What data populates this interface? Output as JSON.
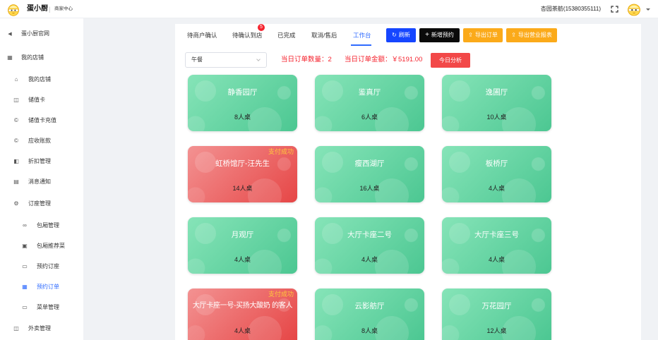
{
  "header": {
    "brand": "蛋小厨",
    "separator": "|",
    "subtitle": "商家中心",
    "account": "杏园茶舫(15380355111)",
    "logo_icon": "egg-mascot-logo",
    "fullscreen_icon": "fullscreen-icon",
    "avatar_icon": "egg-mascot-avatar",
    "dropdown_icon": "caret-down-icon"
  },
  "sidebar": {
    "items": [
      {
        "label": "蛋小厨官网",
        "icon": "send-icon"
      },
      {
        "label": "我的店铺",
        "icon": "store-icon"
      },
      {
        "label": "我的店铺",
        "icon": "shop-icon"
      },
      {
        "label": "储值卡",
        "icon": "card-icon"
      },
      {
        "label": "储值卡充值",
        "icon": "coin-icon"
      },
      {
        "label": "应收账款",
        "icon": "coin-icon"
      },
      {
        "label": "折扣管理",
        "icon": "tag-icon"
      },
      {
        "label": "消息通知",
        "icon": "message-icon"
      },
      {
        "label": "订座管理",
        "icon": "gear-icon"
      },
      {
        "label": "包厢管理",
        "icon": "link-icon"
      },
      {
        "label": "包厢推荐菜",
        "icon": "dish-icon"
      },
      {
        "label": "预约订座",
        "icon": "keyboard-icon"
      },
      {
        "label": "预约订单",
        "icon": "order-grid-icon",
        "active": true
      },
      {
        "label": "菜单管理",
        "icon": "menu-icon"
      },
      {
        "label": "外卖管理",
        "icon": "takeaway-icon"
      }
    ]
  },
  "tabs": [
    {
      "label": "待商户确认"
    },
    {
      "label": "待确认到店",
      "badge": "5"
    },
    {
      "label": "已完成"
    },
    {
      "label": "取消/售后"
    },
    {
      "label": "工作台",
      "active": true
    }
  ],
  "toolbar": {
    "refresh": {
      "label": "刷新",
      "icon": "refresh-icon",
      "color": "#1646ff"
    },
    "new_booking": {
      "label": "新增预约",
      "icon": "plus-icon",
      "color": "#0a0a0a"
    },
    "export_orders": {
      "label": "导出订单",
      "icon": "export-icon",
      "color": "#fbaa1a"
    },
    "export_report": {
      "label": "导出营业报表",
      "icon": "export-icon",
      "color": "#fbaa1a"
    }
  },
  "filters": {
    "meal_period": "午餐",
    "order_count_label": "当日订单数量：",
    "order_count": "2",
    "order_amount_label": "当日订单金额：",
    "order_amount": "￥5191.00",
    "analysis_button": "今日分析"
  },
  "colors": {
    "accent": "#2f6bff",
    "available_card": "#5fd29c",
    "paid_card": "#ec5a5a",
    "paid_status_text": "#ffc93c",
    "stat_text": "#f5222d",
    "analysis_button": "#f24848"
  },
  "rooms": [
    {
      "name": "静香园厅",
      "seats": "8人桌"
    },
    {
      "name": "鉴真厅",
      "seats": "6人桌"
    },
    {
      "name": "逸圃厅",
      "seats": "10人桌"
    },
    {
      "name": "虹桥馆厅-汪先生",
      "seats": "14人桌",
      "status": "支付成功"
    },
    {
      "name": "瘦西湖厅",
      "seats": "16人桌"
    },
    {
      "name": "板桥厅",
      "seats": "4人桌"
    },
    {
      "name": "月观厅",
      "seats": "4人桌"
    },
    {
      "name": "大厅卡座二号",
      "seats": "4人桌"
    },
    {
      "name": "大厅卡座三号",
      "seats": "4人桌"
    },
    {
      "name": "大厅卡座一号-买扬大酸奶 的客人",
      "seats": "4人桌",
      "status": "支付成功"
    },
    {
      "name": "云影舫厅",
      "seats": "8人桌"
    },
    {
      "name": "万花园厅",
      "seats": "12人桌"
    }
  ]
}
